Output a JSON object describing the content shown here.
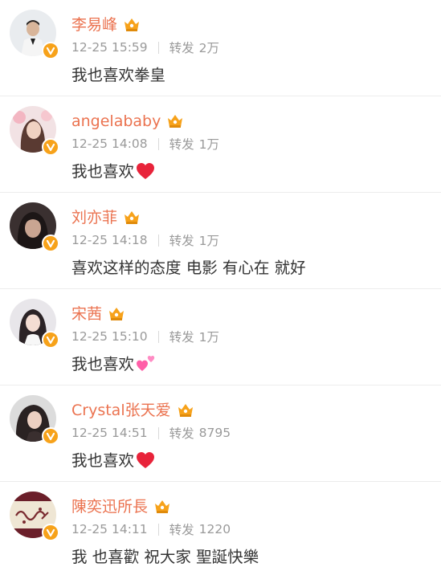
{
  "colors": {
    "username": "#eb7350",
    "meta": "#9a9a9a",
    "text": "#333333",
    "divider": "#ececec",
    "verified_badge": "#f7a21a",
    "heart": "#e8233a",
    "pink_hearts": "#ff5fa8"
  },
  "posts": [
    {
      "username": "李易峰",
      "date": "12-25 15:59",
      "repost_label": "转发",
      "repost_count": "2万",
      "text": "我也喜欢拳皇",
      "emoji": null
    },
    {
      "username": "angelababy",
      "date": "12-25 14:08",
      "repost_label": "转发",
      "repost_count": "1万",
      "text": "我也喜欢",
      "emoji": "red-heart-icon"
    },
    {
      "username": "刘亦菲",
      "date": "12-25 14:18",
      "repost_label": "转发",
      "repost_count": "1万",
      "text": "喜欢这样的态度 电影 有心在 就好",
      "emoji": null
    },
    {
      "username": "宋茜",
      "date": "12-25 15:10",
      "repost_label": "转发",
      "repost_count": "1万",
      "text": "我也喜欢",
      "emoji": "two-pink-hearts-icon"
    },
    {
      "username": "Crystal张天爱",
      "date": "12-25 14:51",
      "repost_label": "转发",
      "repost_count": "8795",
      "text": "我也喜欢",
      "emoji": "red-heart-icon"
    },
    {
      "username": "陳奕迅所長",
      "date": "12-25 14:11",
      "repost_label": "转发",
      "repost_count": "1220",
      "text": "我 也喜歡 祝大家 聖誕快樂",
      "emoji": null
    }
  ]
}
